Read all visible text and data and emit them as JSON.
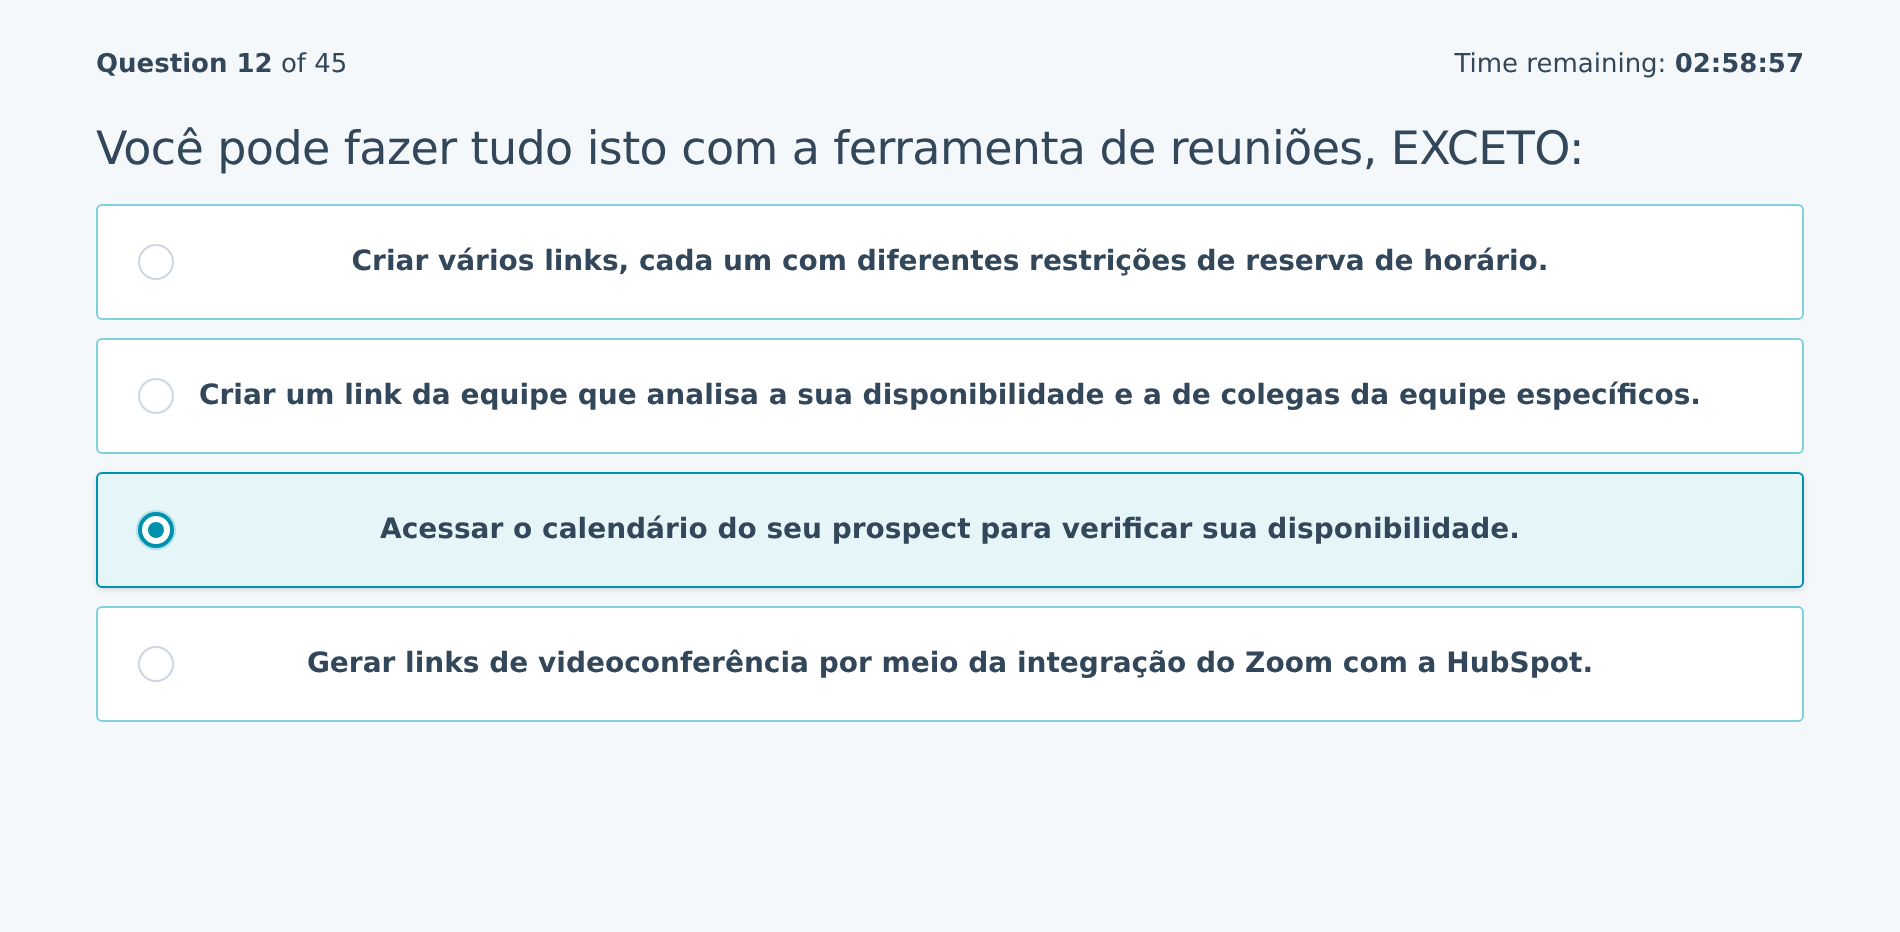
{
  "header": {
    "question_counter": "**Question 12** of 45",
    "time_label": "Time remaining: **02:58:57**"
  },
  "question": "Você pode fazer tudo isto com a ferramenta de reuniões, EXCETO:",
  "options": [
    {
      "label": "Criar vários links, cada um com diferentes restrições de reserva de horário.",
      "selected": false
    },
    {
      "label": "Criar um link da equipe que analisa a sua disponibilidade e a de colegas da equipe específicos.",
      "selected": false
    },
    {
      "label": "Acessar o calendário do seu prospect para verificar sua disponibilidade.",
      "selected": true
    },
    {
      "label": "Gerar links de videoconferência por meio da integração do Zoom com a HubSpot.",
      "selected": false
    }
  ]
}
